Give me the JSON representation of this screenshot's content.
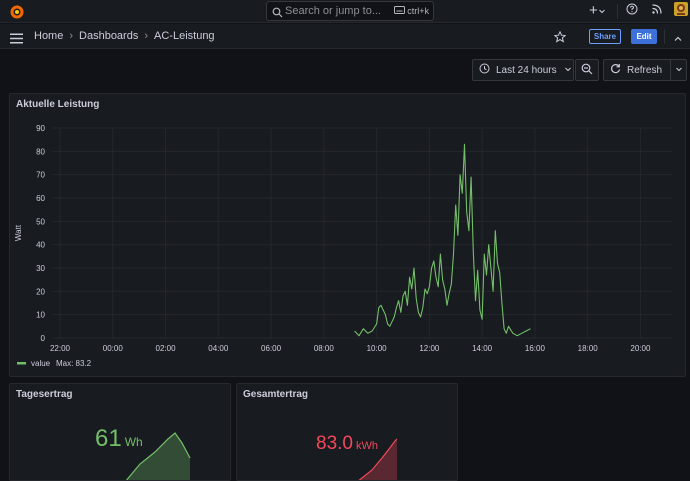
{
  "topbar": {
    "search_placeholder": "Search or jump to...",
    "search_shortcut": "ctrl+k",
    "plus_label": "+"
  },
  "breadcrumb": [
    "Home",
    "Dashboards",
    "AC-Leistung"
  ],
  "nav": {
    "share_label": "Share",
    "edit_label": "Edit"
  },
  "controls": {
    "time_range": "Last 24 hours",
    "refresh_label": "Refresh"
  },
  "panels": {
    "main": {
      "title": "Aktuelle Leistung"
    },
    "tagesertrag": {
      "title": "Tagesertrag",
      "value": "61",
      "unit": "Wh",
      "color": "#73bf69"
    },
    "gesamtertrag": {
      "title": "Gesamtertrag",
      "value": "83.0",
      "unit": "kWh",
      "color": "#f2495c"
    }
  },
  "chart_data": {
    "type": "line",
    "title": "Aktuelle Leistung",
    "ylabel": "Watt",
    "xlabel": "",
    "ylim": [
      0,
      90
    ],
    "yticks": [
      0,
      10,
      20,
      30,
      40,
      50,
      60,
      70,
      80,
      90
    ],
    "xticks": [
      "22:00",
      "00:00",
      "02:00",
      "04:00",
      "06:00",
      "08:00",
      "10:00",
      "12:00",
      "14:00",
      "16:00",
      "18:00",
      "20:00"
    ],
    "xlim_hours": [
      22,
      45.5
    ],
    "grid": true,
    "legend": {
      "placement": "bottom-left",
      "entries": [
        {
          "name": "value",
          "stat": "Max: 83.2"
        }
      ]
    },
    "series": [
      {
        "name": "value",
        "color": "#73bf69",
        "x": [
          "09:10",
          "09:20",
          "09:30",
          "09:40",
          "09:50",
          "10:00",
          "10:05",
          "10:10",
          "10:15",
          "10:20",
          "10:25",
          "10:30",
          "10:35",
          "10:40",
          "10:45",
          "10:50",
          "10:55",
          "11:00",
          "11:05",
          "11:10",
          "11:15",
          "11:20",
          "11:25",
          "11:30",
          "11:35",
          "11:40",
          "11:45",
          "11:50",
          "11:55",
          "12:00",
          "12:05",
          "12:10",
          "12:15",
          "12:20",
          "12:25",
          "12:30",
          "12:35",
          "12:40",
          "12:45",
          "12:50",
          "12:55",
          "13:00",
          "13:05",
          "13:10",
          "13:15",
          "13:20",
          "13:25",
          "13:30",
          "13:35",
          "13:40",
          "13:45",
          "13:50",
          "13:55",
          "14:00",
          "14:05",
          "14:10",
          "14:15",
          "14:20",
          "14:25",
          "14:30",
          "14:35",
          "14:40",
          "14:45",
          "14:50",
          "14:55",
          "15:00",
          "15:10",
          "15:20",
          "15:30",
          "15:40",
          "15:50"
        ],
        "values": [
          3,
          1,
          4,
          2,
          3,
          6,
          13,
          14,
          12,
          10,
          6,
          5,
          7,
          9,
          13,
          16,
          11,
          18,
          20,
          14,
          26,
          21,
          30,
          17,
          11,
          9,
          13,
          21,
          19,
          22,
          30,
          33,
          26,
          22,
          36,
          25,
          21,
          14,
          19,
          23,
          36,
          57,
          44,
          70,
          62,
          83,
          54,
          46,
          69,
          37,
          16,
          29,
          12,
          8,
          36,
          27,
          40,
          30,
          20,
          46,
          32,
          28,
          15,
          4,
          2,
          5,
          2,
          1,
          2,
          3,
          4
        ]
      }
    ]
  }
}
